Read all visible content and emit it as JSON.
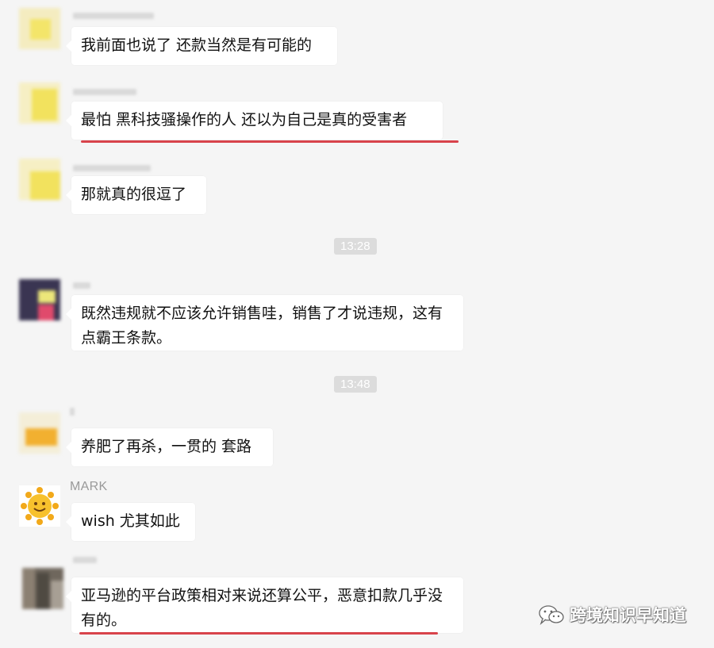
{
  "messages": [
    {
      "text": "我前面也说了 还款当然是有可能的",
      "highlighted": false
    },
    {
      "text": "最怕 黑科技骚操作的人 还以为自己是真的受害者",
      "highlighted": true
    },
    {
      "text": "那就真的很逗了",
      "highlighted": false
    },
    {
      "text": "既然违规就不应该允许销售哇，销售了才说违规，这有点霸王条款。",
      "highlighted": false
    },
    {
      "text": "养肥了再杀，一贯的 套路",
      "highlighted": false
    },
    {
      "sender": "MARK",
      "text": "wish 尤其如此",
      "highlighted": false
    },
    {
      "text": "亚马逊的平台政策相对来说还算公平，恶意扣款几乎没有的。",
      "highlighted": true
    }
  ],
  "timestamps": [
    "13:28",
    "13:48"
  ],
  "watermark": "跨境知识早知道",
  "colors": {
    "background": "#f5f5f5",
    "bubble": "#ffffff",
    "underline": "#d8434b",
    "timestamp_bg": "#dcdcdc"
  }
}
